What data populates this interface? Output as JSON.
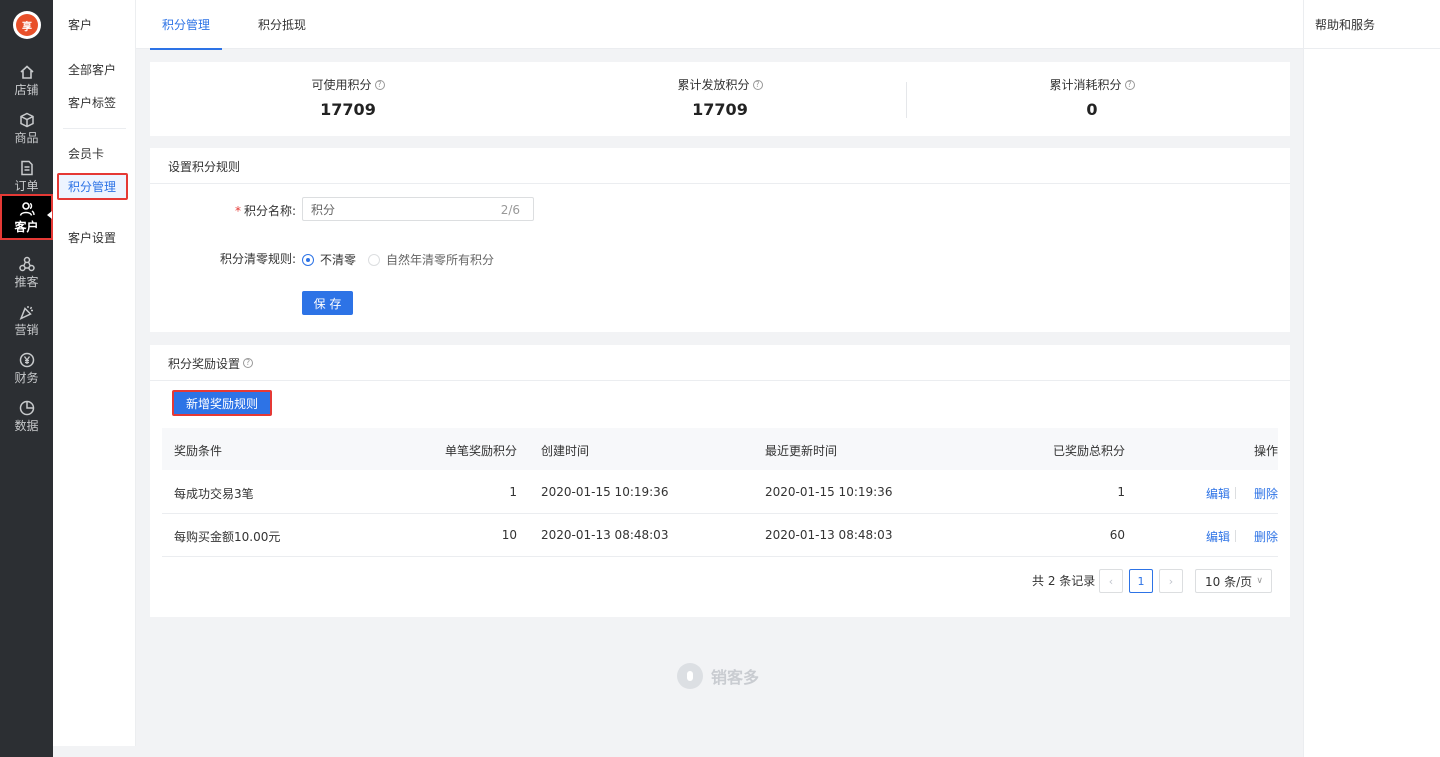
{
  "logo": {
    "text": "享"
  },
  "leftnav": {
    "items": [
      {
        "label": "店铺",
        "icon": "home-icon"
      },
      {
        "label": "商品",
        "icon": "box-icon"
      },
      {
        "label": "订单",
        "icon": "order-icon"
      },
      {
        "label": "客户",
        "icon": "user-icon",
        "active": true
      },
      {
        "label": "推客",
        "icon": "share-icon"
      },
      {
        "label": "营销",
        "icon": "party-icon"
      },
      {
        "label": "财务",
        "icon": "yen-icon"
      },
      {
        "label": "数据",
        "icon": "pie-icon"
      }
    ]
  },
  "submenu": {
    "head": "客户",
    "items": [
      "全部客户",
      "客户标签",
      "会员卡",
      "积分管理",
      "客户设置"
    ],
    "selected": "积分管理"
  },
  "tabs": [
    {
      "label": "积分管理",
      "active": true
    },
    {
      "label": "积分抵现",
      "active": false
    }
  ],
  "help": {
    "title": "帮助和服务"
  },
  "stats": [
    {
      "label": "可使用积分",
      "value": "17709"
    },
    {
      "label": "累计发放积分",
      "value": "17709"
    },
    {
      "label": "累计消耗积分",
      "value": "0"
    }
  ],
  "rules": {
    "title": "设置积分规则",
    "name_label": "积分名称:",
    "name_value": "积分",
    "name_count": "2/6",
    "clear_label": "积分清零规则:",
    "options": [
      "不清零",
      "自然年清零所有积分"
    ],
    "save_label": "保 存"
  },
  "rewards": {
    "title": "积分奖励设置",
    "add_label": "新增奖励规则",
    "columns": [
      "奖励条件",
      "单笔奖励积分",
      "创建时间",
      "最近更新时间",
      "已奖励总积分",
      "操作"
    ],
    "rows": [
      {
        "condition": "每成功交易3笔",
        "points": "1",
        "created": "2020-01-15 10:19:36",
        "updated": "2020-01-15 10:19:36",
        "total": "1",
        "edit": "编辑",
        "delete": "删除"
      },
      {
        "condition": "每购买金额10.00元",
        "points": "10",
        "created": "2020-01-13 08:48:03",
        "updated": "2020-01-13 08:48:03",
        "total": "60",
        "edit": "编辑",
        "delete": "删除"
      }
    ],
    "pager": {
      "total": "共 2 条记录",
      "prev": "‹",
      "page": "1",
      "next": "›",
      "size": "10 条/页",
      "chevron": "∨"
    }
  },
  "footer": {
    "brand": "销客多"
  },
  "colors": {
    "accent": "#2d73e6",
    "highlight": "#e53935",
    "nav_bg": "#2c2f33"
  }
}
